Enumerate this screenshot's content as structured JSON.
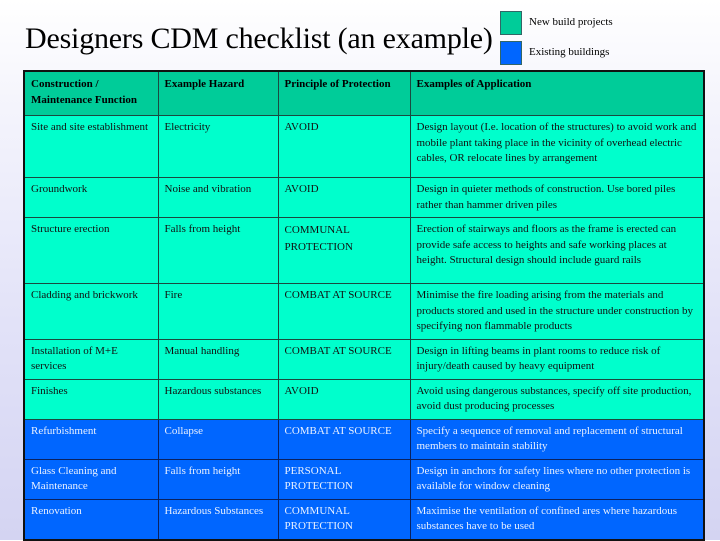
{
  "title": "Designers CDM checklist (an example)",
  "legend": [
    {
      "label": "New build projects",
      "color": "#00cc99"
    },
    {
      "label": "Existing buildings",
      "color": "#0066ff"
    }
  ],
  "table": {
    "headers": [
      "Construction / Maintenance Function",
      "Example Hazard",
      "Principle of Protection",
      "Examples of Application"
    ],
    "rows": [
      {
        "category": "new-build",
        "function": "Site and site establishment",
        "hazard": "Electricity",
        "principle": "AVOID",
        "application": "Design layout (I.e. location of the structures) to avoid work and mobile plant taking place in the vicinity of overhead electric cables, OR relocate lines by arrangement"
      },
      {
        "category": "new-build",
        "function": "Groundwork",
        "hazard": "Noise and vibration",
        "principle": "AVOID",
        "application": "Design in quieter methods of construction.  Use bored piles rather than hammer driven piles"
      },
      {
        "category": "new-build",
        "function": "Structure erection",
        "hazard": "Falls from height",
        "principle": "COMMUNAL PROTECTION",
        "application": "Erection of stairways and floors as the frame is erected can provide safe access to heights and safe working places at height.  Structural design should include guard rails"
      },
      {
        "category": "new-build",
        "function": "Cladding and brickwork",
        "hazard": "Fire",
        "principle": "COMBAT AT SOURCE",
        "application": "Minimise the fire loading arising from the materials and products stored and used in the structure under construction by specifying non flammable products"
      },
      {
        "category": "new-build",
        "function": "Installation of M+E services",
        "hazard": "Manual handling",
        "principle": "COMBAT AT SOURCE",
        "application": "Design in lifting beams in plant rooms to reduce risk of injury/death caused by heavy equipment"
      },
      {
        "category": "new-build",
        "function": "Finishes",
        "hazard": "Hazardous substances",
        "principle": "AVOID",
        "application": "Avoid using dangerous substances, specify off site production, avoid dust producing processes"
      },
      {
        "category": "existing",
        "function": "Refurbishment",
        "hazard": "Collapse",
        "principle": "COMBAT AT SOURCE",
        "application": "Specify a sequence of removal and replacement of structural members to maintain stability"
      },
      {
        "category": "existing",
        "function": "Glass Cleaning and Maintenance",
        "hazard": "Falls from height",
        "principle": "PERSONAL PROTECTION",
        "application": "Design in anchors for safety lines where no other protection is available for window cleaning"
      },
      {
        "category": "existing",
        "function": "Renovation",
        "hazard": "Hazardous Substances",
        "principle": "COMMUNAL PROTECTION",
        "application": "Maximise the ventilation of confined ares where hazardous substances have to be used"
      }
    ]
  }
}
